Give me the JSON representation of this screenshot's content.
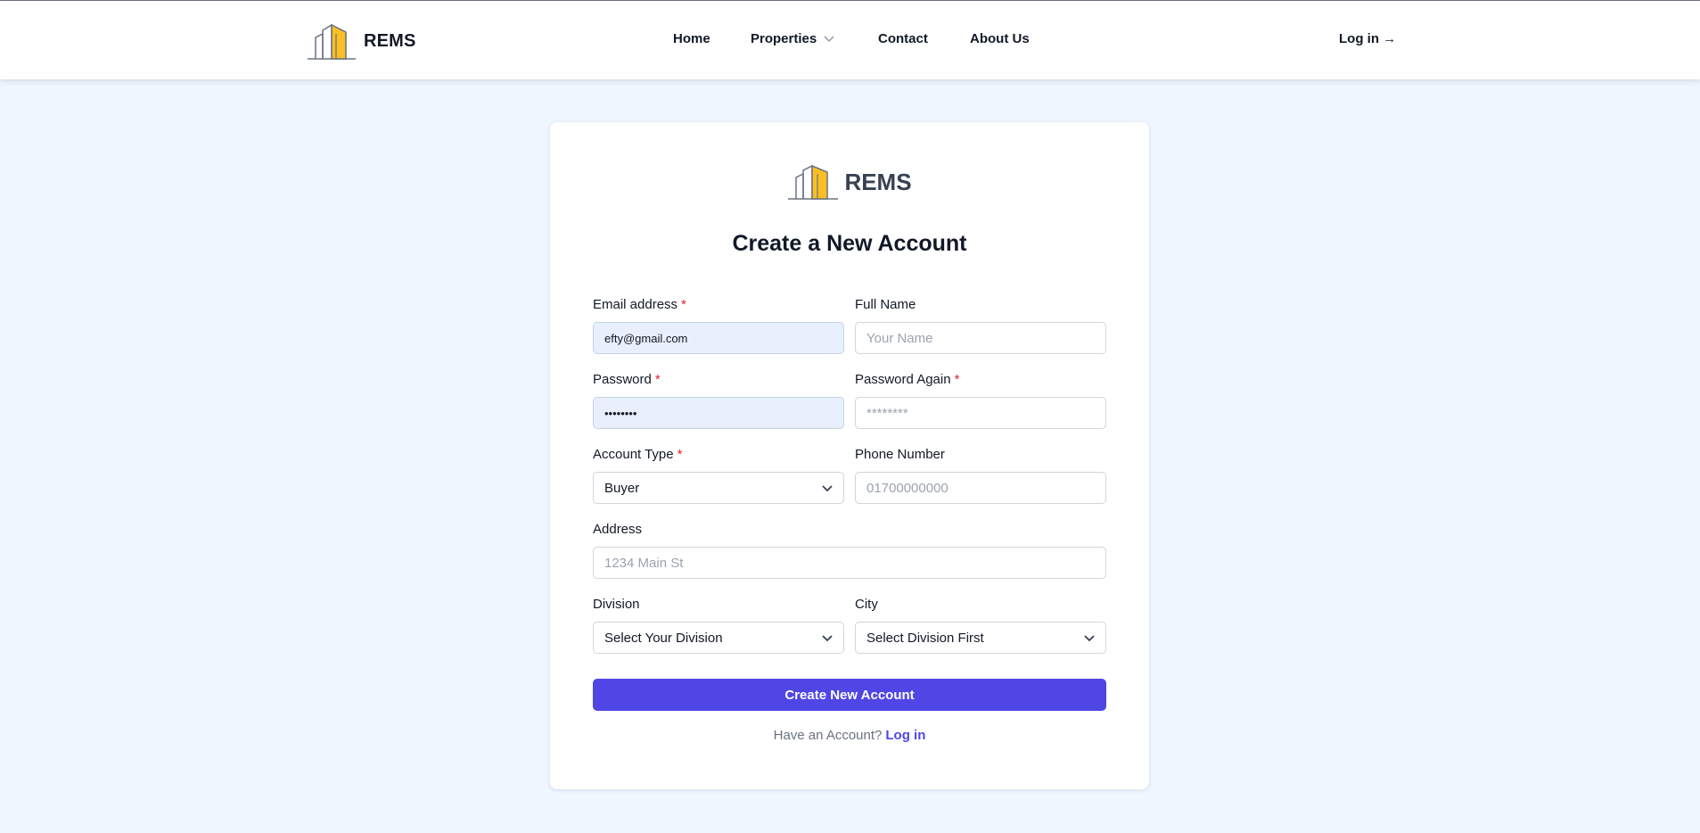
{
  "brand": {
    "name": "REMS"
  },
  "nav": {
    "items": [
      {
        "label": "Home"
      },
      {
        "label": "Properties"
      },
      {
        "label": "Contact"
      },
      {
        "label": "About Us"
      }
    ],
    "login": "Log in →"
  },
  "form": {
    "logo_text": "REMS",
    "title": "Create a New Account",
    "email": {
      "label": "Email address",
      "required": "*",
      "value": "efty@gmail.com"
    },
    "full_name": {
      "label": "Full Name",
      "placeholder": "Your Name"
    },
    "password": {
      "label": "Password",
      "required": "*",
      "value": "••••••••"
    },
    "password_again": {
      "label": "Password Again",
      "required": "*",
      "placeholder": "********"
    },
    "account_type": {
      "label": "Account Type",
      "required": "*",
      "value": "Buyer"
    },
    "phone": {
      "label": "Phone Number",
      "placeholder": "01700000000"
    },
    "address": {
      "label": "Address",
      "placeholder": "1234 Main St"
    },
    "division": {
      "label": "Division",
      "value": "Select Your Division"
    },
    "city": {
      "label": "City",
      "value": "Select Division First"
    },
    "submit_label": "Create New Account",
    "footer_text": "Have an Account?",
    "footer_link": "Log in"
  },
  "colors": {
    "accent": "#4f46e5",
    "page_background": "#eff6ff",
    "required": "#dc2626",
    "logo_yellow": "#fbbf24"
  },
  "icons": [
    "building-logo-icon",
    "chevron-down-icon"
  ]
}
